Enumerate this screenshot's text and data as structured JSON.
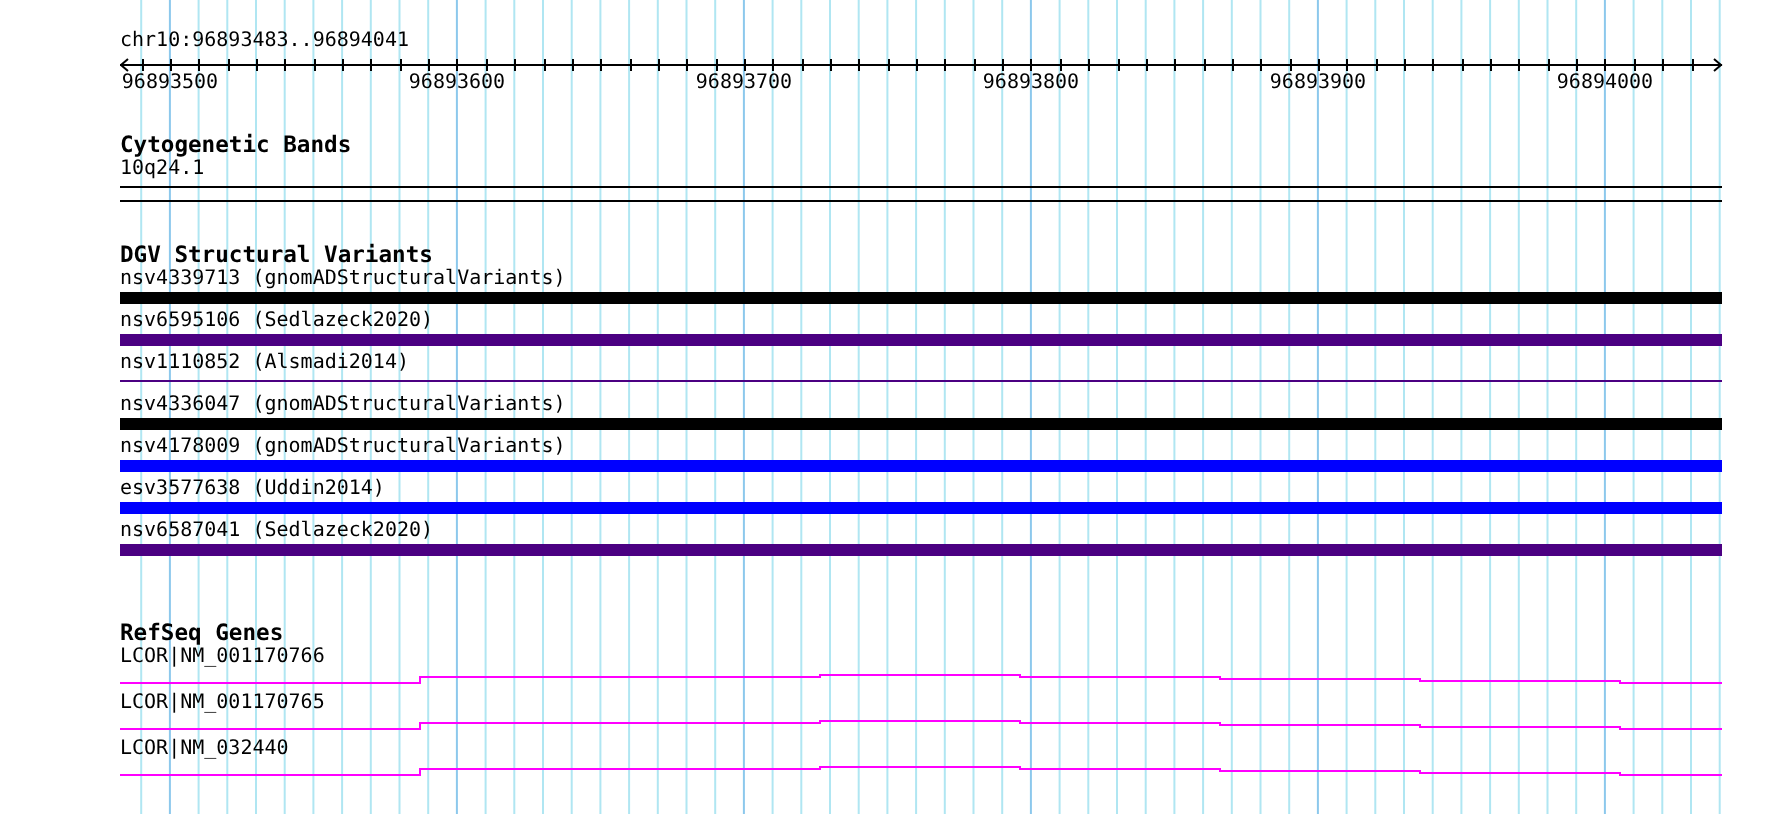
{
  "ruler": {
    "title": "chr10:96893483..96894041",
    "labels": [
      "96893500",
      "96893600",
      "96893700",
      "96893800",
      "96893900",
      "96894000"
    ]
  },
  "tracks": [
    {
      "kind": "cytoband",
      "title": "Cytogenetic Bands",
      "features": [
        {
          "label": "10q24.1"
        }
      ]
    },
    {
      "kind": "variants",
      "title": "DGV Structural Variants",
      "features": [
        {
          "label": "nsv4339713 (gnomADStructuralVariants)",
          "color": "#000000",
          "kind": "thick"
        },
        {
          "label": "nsv6595106 (Sedlazeck2020)",
          "color": "#4b0082",
          "kind": "thick"
        },
        {
          "label": "nsv1110852 (Alsmadi2014)",
          "color": "#4b0082",
          "kind": "thin"
        },
        {
          "label": "nsv4336047 (gnomADStructuralVariants)",
          "color": "#000000",
          "kind": "thick"
        },
        {
          "label": "nsv4178009 (gnomADStructuralVariants)",
          "color": "#0000ff",
          "kind": "thick"
        },
        {
          "label": "esv3577638 (Uddin2014)",
          "color": "#0000ff",
          "kind": "thick"
        },
        {
          "label": "nsv6587041 (Sedlazeck2020)",
          "color": "#4b0082",
          "kind": "thick"
        }
      ]
    },
    {
      "kind": "genes",
      "title": "RefSeq Genes",
      "features": [
        {
          "label": "LCOR|NM_001170766"
        },
        {
          "label": "LCOR|NM_001170765"
        },
        {
          "label": "LCOR|NM_032440"
        }
      ]
    }
  ]
}
